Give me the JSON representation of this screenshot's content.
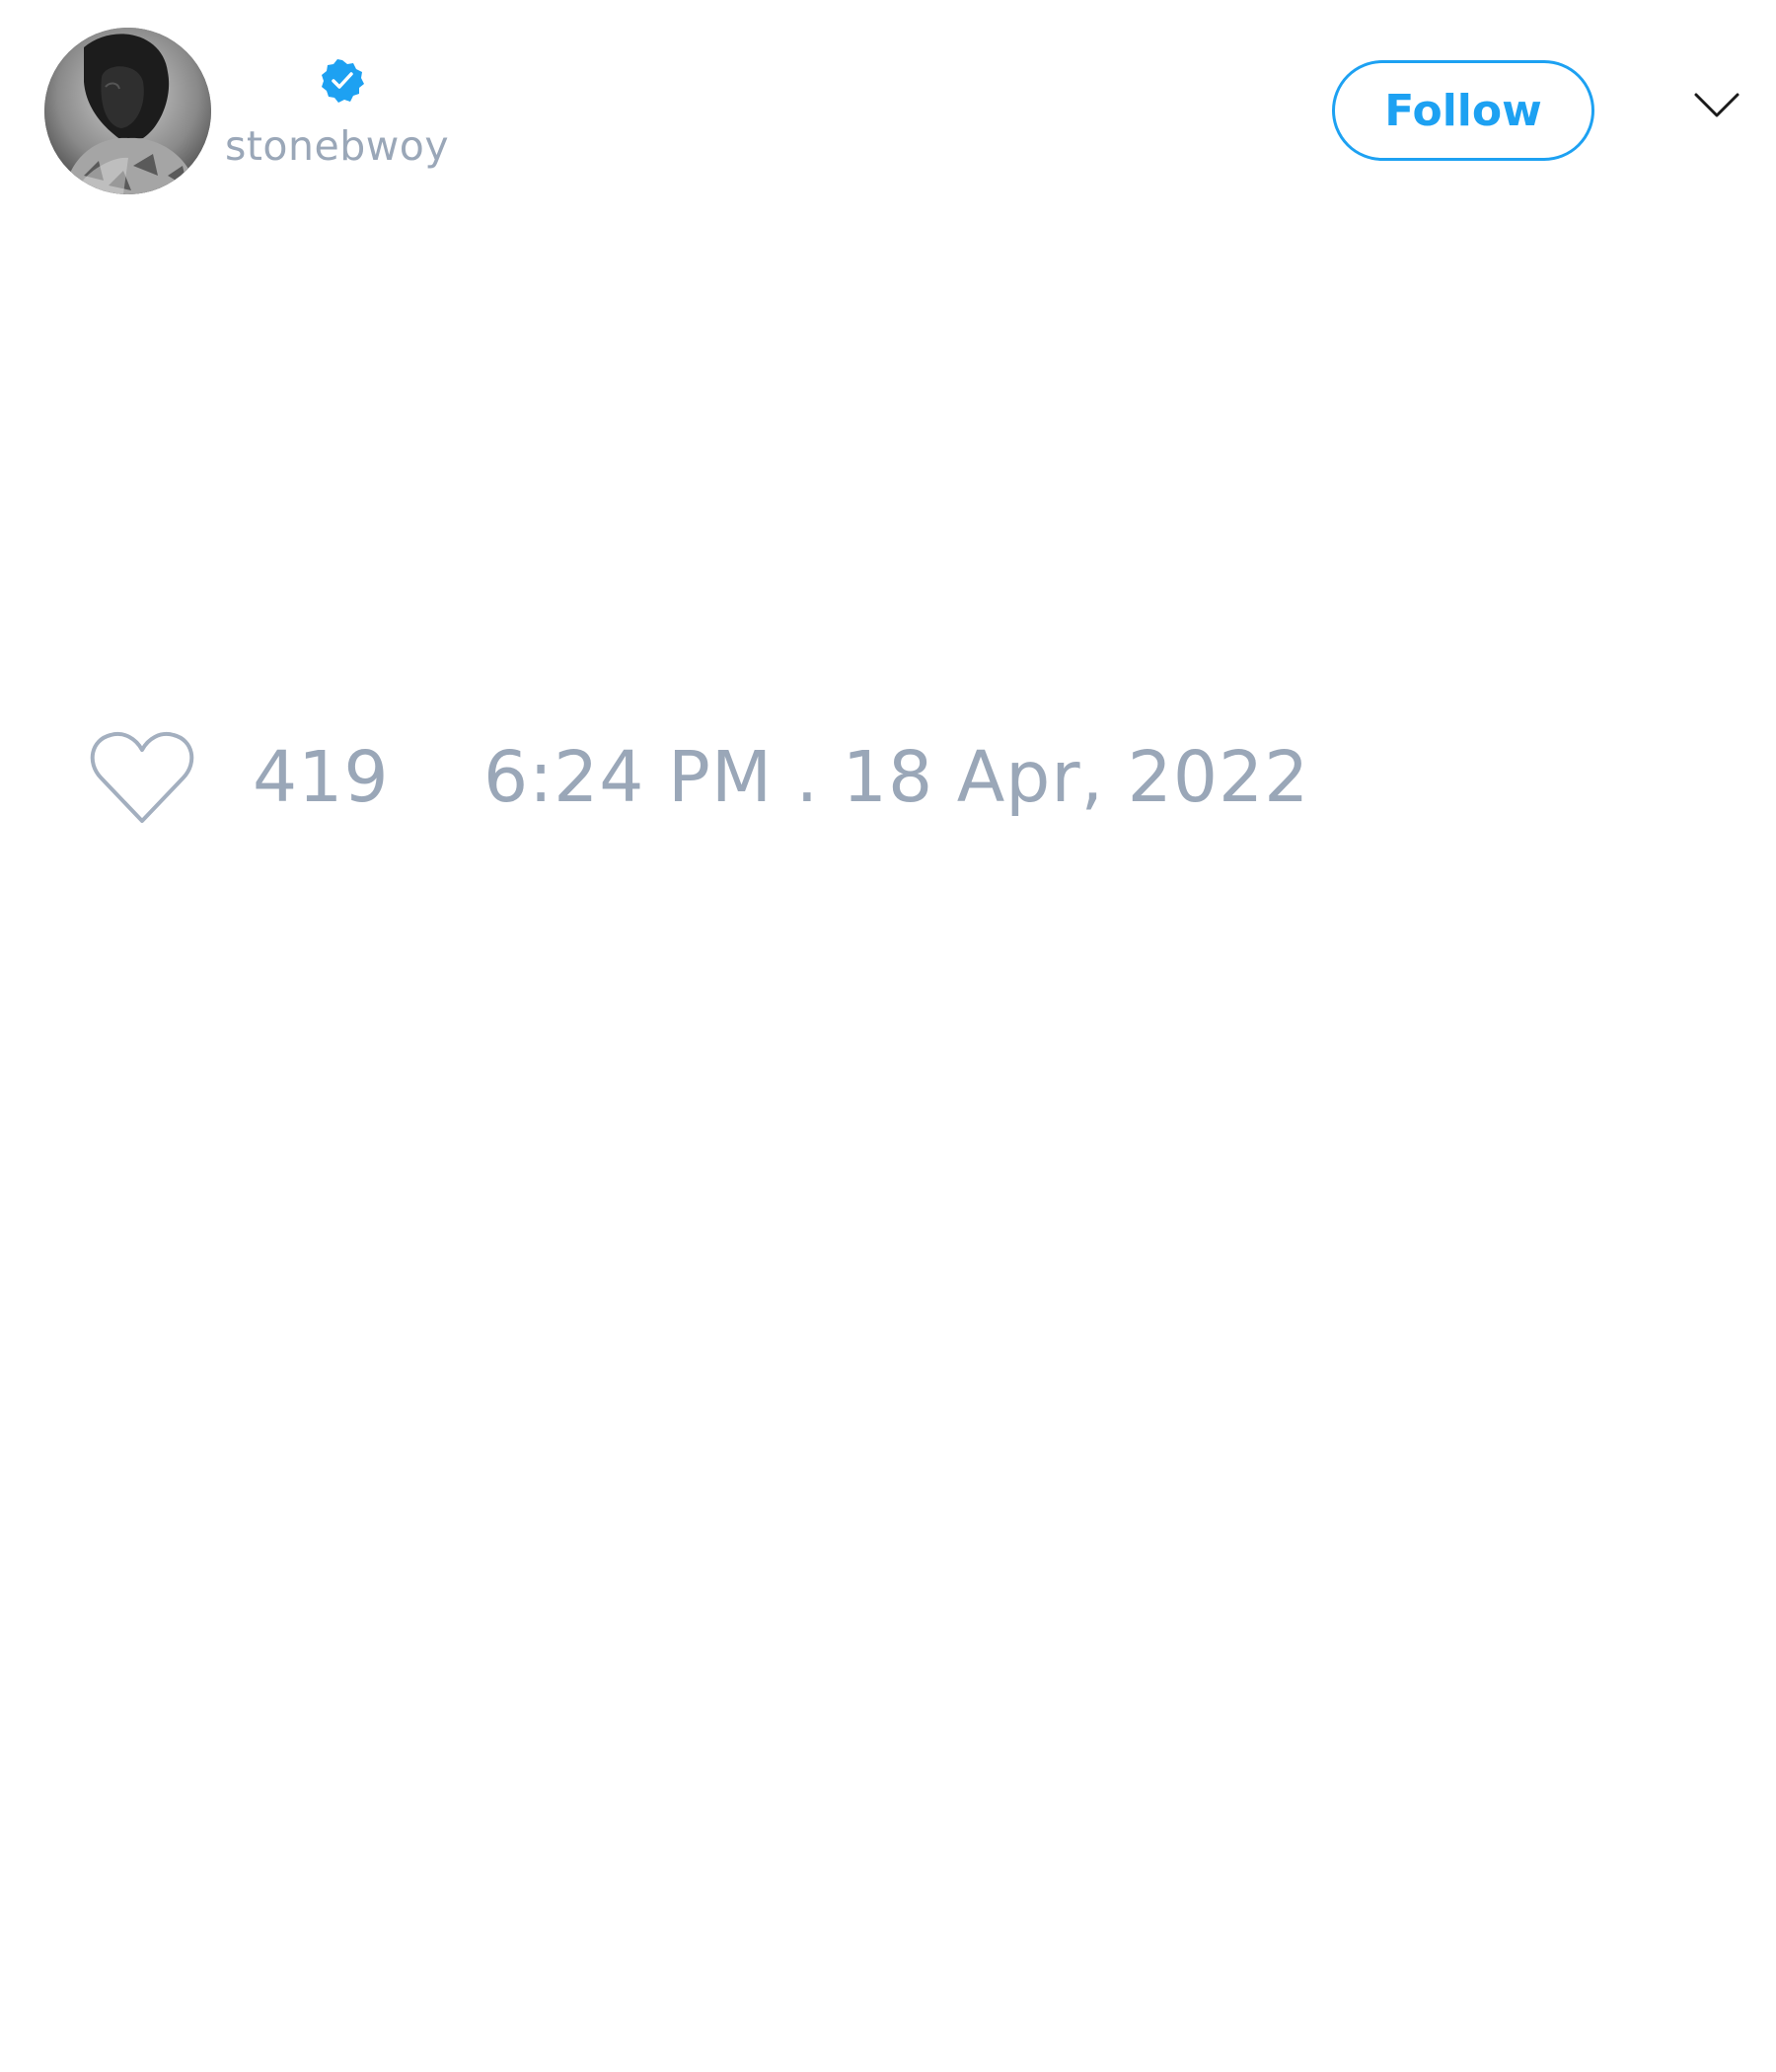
{
  "tweet": {
    "author": {
      "display_name": "",
      "handle": "stonebwoy",
      "verified": true,
      "avatar_icon": "profile-photo"
    },
    "follow_label": "Follow",
    "menu_icon": "chevron-down-icon",
    "likes": {
      "icon": "heart-icon",
      "count": "419"
    },
    "timestamp": "6:24 PM . 18 Apr, 2022"
  },
  "colors": {
    "accent": "#1da1f2",
    "muted_text": "#9aa7b8",
    "background": "#ffffff"
  }
}
